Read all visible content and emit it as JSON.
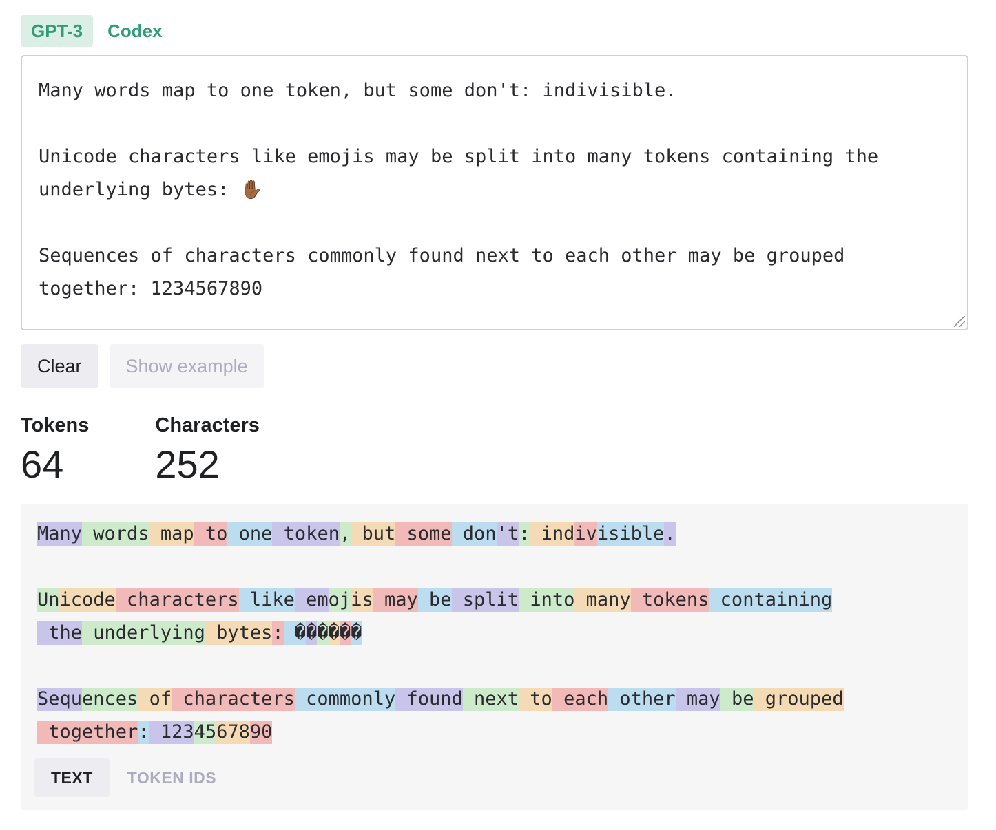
{
  "model_tabs": [
    {
      "label": "GPT-3",
      "active": true
    },
    {
      "label": "Codex",
      "active": false
    }
  ],
  "input": {
    "paragraphs": [
      "Many words map to one token, but some don't: indivisible.",
      "Unicode characters like emojis may be split into many tokens containing the underlying bytes: ",
      "Sequences of characters commonly found next to each other may be grouped together: 1234567890"
    ],
    "emoji": "✋🏾"
  },
  "buttons": {
    "clear_label": "Clear",
    "show_example_label": "Show example"
  },
  "stats": {
    "tokens_label": "Tokens",
    "tokens_value": "64",
    "characters_label": "Characters",
    "characters_value": "252"
  },
  "tokenized_lines": [
    [
      "Many",
      " words",
      " map",
      " to",
      " one",
      " token",
      ",",
      " but",
      " some",
      " don",
      "'t",
      ":",
      " ind",
      "iv",
      "isible",
      "."
    ],
    [],
    [
      "Un",
      "icode",
      " characters",
      " like",
      " em",
      "oj",
      "is",
      " may",
      " be",
      " split",
      " into",
      " many",
      " tokens",
      " containing"
    ],
    [
      " the",
      " underlying",
      " bytes",
      ":",
      " �",
      "�",
      "�",
      "�",
      "�",
      "�"
    ],
    [],
    [
      "Sequ",
      "ences",
      " of",
      " characters",
      " commonly",
      " found",
      " next",
      " to",
      " each",
      " other",
      " may",
      " be",
      " grouped"
    ],
    [
      " together",
      ":",
      " 123",
      "45",
      "678",
      "90"
    ]
  ],
  "token_colors": [
    "#c9c4ea",
    "#cdebcb",
    "#f4dbb6",
    "#f1b9b8",
    "#bcdcef"
  ],
  "view_tabs": [
    {
      "label": "TEXT",
      "active": true
    },
    {
      "label": "TOKEN IDS",
      "active": false
    }
  ]
}
